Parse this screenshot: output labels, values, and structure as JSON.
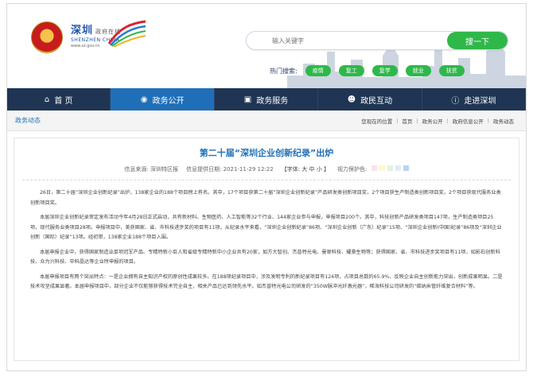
{
  "header": {
    "logo_cn": "深圳",
    "logo_cn_sub": "政府在线",
    "logo_en": "SHENZHEN CHINA",
    "logo_url": "www.sz.gov.cn",
    "search_placeholder": "输入关键字",
    "search_button": "搜一下",
    "hot_label": "热门搜索:",
    "hot_items": [
      "疫情",
      "复工",
      "复学",
      "就业",
      "扶贫"
    ]
  },
  "nav": {
    "items": [
      {
        "label": "首 页",
        "icon": "home-icon"
      },
      {
        "label": "政务公开",
        "icon": "radio-icon"
      },
      {
        "label": "政务服务",
        "icon": "monitor-icon"
      },
      {
        "label": "政民互动",
        "icon": "people-icon"
      },
      {
        "label": "走进深圳",
        "icon": "info-icon"
      }
    ],
    "active_index": 1
  },
  "breadcrumb": {
    "section": "政务动态",
    "position_label": "您现在的位置",
    "items": [
      "首页",
      "政务公开",
      "政府信息公开",
      "政务动态"
    ]
  },
  "article": {
    "title": "第二十届“深圳企业创新纪录”出炉",
    "source_label": "信息来源:",
    "source": "深圳特区报",
    "date_label": "信息提供日期:",
    "date": "2021-11-29 12:22",
    "font_label": "【字体:",
    "font_large": "大",
    "font_mid": "中",
    "font_small": "小",
    "font_end": "】",
    "vision_label": "视力保护色:",
    "vision_colors": [
      "#fbe3ea",
      "#fdf8cf",
      "#e1f3e3",
      "#e3ecf8",
      "#b9d3f1"
    ],
    "paragraphs": [
      "26日，第二十届“深圳企业创新纪录”出炉，138家企业的188个项目榜上有名。其中，17个项目获第二十届“深圳企业创新纪录”产品研发类创新项目奖，2个项目获生产制造类创新项目奖，2个项目获现代服务业类创新项目奖。",
      "本届深圳企业创新纪录审定发布活动今年4月28日正式启动，共有新材料、生物医药、人工智能等32个行业、144家企业参与申报，申报项目200个。其中，科技创新产品研发类项目147项，生产制造类项目25项，现代服务业类项目28项。申报项目中，美获国家、省、市科技进步奖的项目有11项。从纪录水平来看，“深圳企业创新纪录”86项、“深圳企业创新（广东）纪录”15项、“深圳企业创新(中国)纪录”86项及“深圳企业创新（国际）纪录”13项。经初审，138家企业188个项目入围。",
      "本届申报企业中，获得国家制造业单项冠军产品、专精特新小巨人和省级专精特新中小企业共有20家，如方大智创、杰普特光电、曼顿科技、耀豪生物等；获得国家、省、市科技进步奖项目有11项，如影石创新科技、众为兴科技、中科晶达等企业所申报的项目。",
      "本届申报项目有两个突出特点：一是企业拥有自主知识产权的原创性成果较多。在188项纪录项目中，涉及发明专利的新纪录项目有124项，占项目总数的65.9%，反映企业自主创新能力突出，创新成果明显。二是技术攻坚成果显著。本届申报项目中，部分企业不仅能够获得技术完全自主，相关产品已达到领先水平。如杰普特光电公司研发的“350W脉冲光纤激光器”，稀海科技公司研发的“碳纳米管纤维复合材料”等。"
    ]
  }
}
